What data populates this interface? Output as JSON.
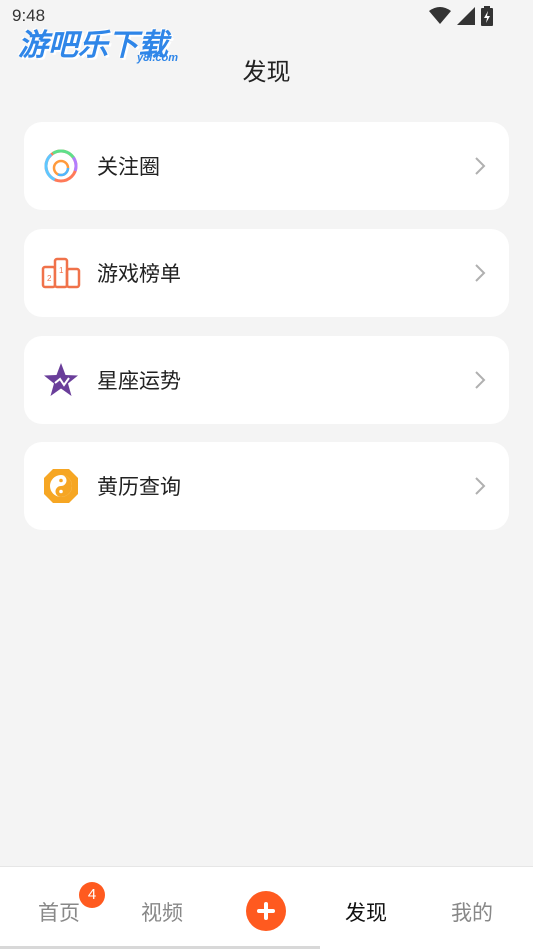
{
  "status": {
    "time": "9:48"
  },
  "watermark": {
    "text": "游吧乐下载",
    "sub": "y8l.com"
  },
  "page": {
    "title": "发现"
  },
  "items": [
    {
      "label": "关注圈",
      "icon": "circle-ring-icon"
    },
    {
      "label": "游戏榜单",
      "icon": "game-cards-icon"
    },
    {
      "label": "星座运势",
      "icon": "star-icon"
    },
    {
      "label": "黄历查询",
      "icon": "yinyang-icon"
    }
  ],
  "tabs": {
    "home": "首页",
    "home_badge": "4",
    "video": "视频",
    "discover": "发现",
    "mine": "我的"
  },
  "colors": {
    "accent": "#ff5a1f",
    "active_tab": "#111111",
    "inactive_tab": "#888888"
  }
}
